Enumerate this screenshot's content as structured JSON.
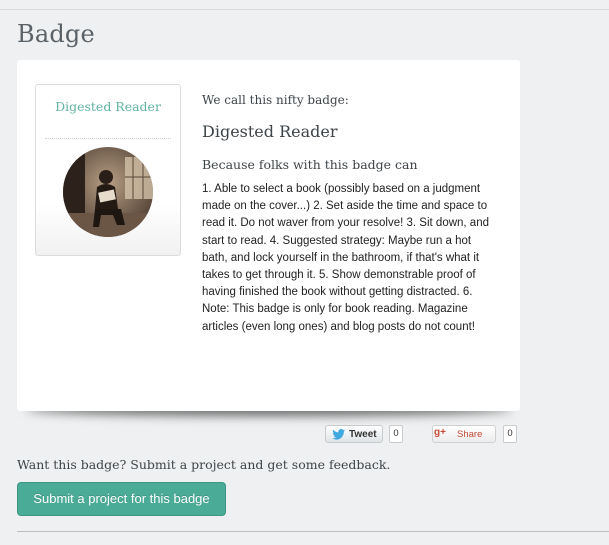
{
  "page": {
    "title": "Badge"
  },
  "badge_card": {
    "box_title": "Digested Reader",
    "image_alt": "Person reading a book in a sunny room",
    "intro": "We call this nifty badge:",
    "name": "Digested Reader",
    "because": "Because folks with this badge can",
    "description": "1. Able to select a book (possibly based on a judgment made on the cover...) 2. Set aside the time and space to read it. Do not waver from your resolve! 3. Sit down, and start to read. 4. Suggested strategy: Maybe run a hot bath, and lock yourself in the bathroom, if that's what it takes to get through it. 5. Show demonstrable proof of having finished the book without getting distracted. 6. Note: This badge is only for book reading. Magazine articles (even long ones) and blog posts do not count!"
  },
  "social": {
    "tweet_label": "Tweet",
    "tweet_count": "0",
    "share_label": "Share",
    "share_count": "0",
    "gplus_glyph": "g+"
  },
  "cta": {
    "prompt": "Want this badge? Submit a project and get some feedback.",
    "button_label": "Submit a project for this badge"
  },
  "colors": {
    "accent": "#4aab96",
    "badge_title": "#5fb3a3",
    "background": "#eef0f1"
  }
}
